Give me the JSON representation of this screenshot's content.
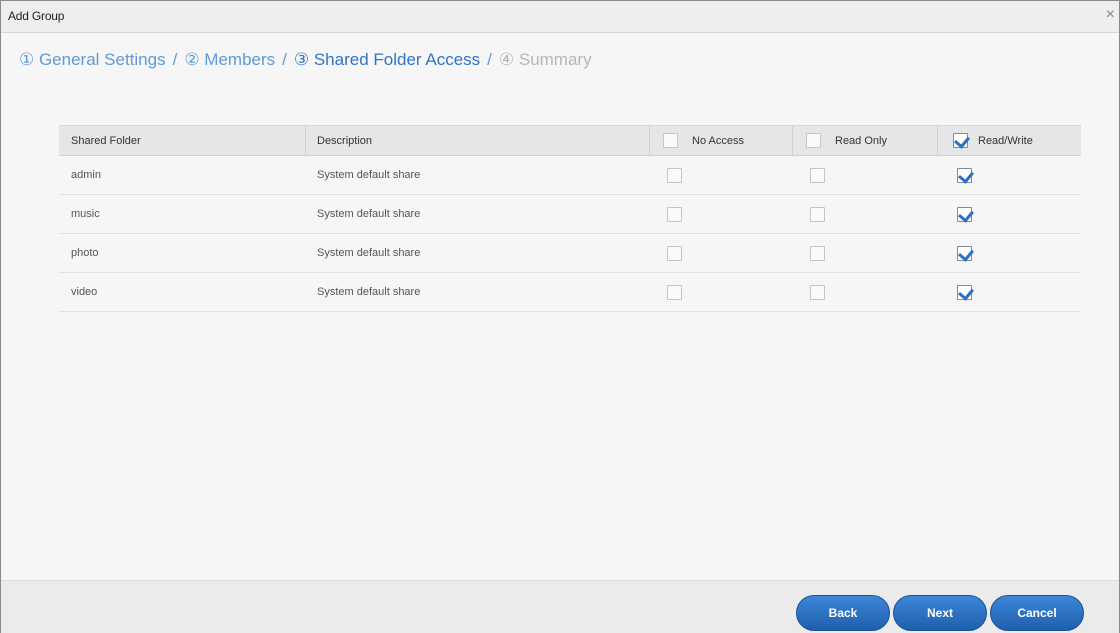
{
  "dialog": {
    "title": "Add Group",
    "close_glyph": "×"
  },
  "steps": [
    {
      "label": "① General Settings",
      "state": "done"
    },
    {
      "label": "② Members",
      "state": "done"
    },
    {
      "label": "③ Shared Folder Access",
      "state": "current"
    },
    {
      "label": "④ Summary",
      "state": "disabled"
    }
  ],
  "step_separator": "/",
  "table": {
    "headers": {
      "folder": "Shared Folder",
      "description": "Description",
      "no_access": "No Access",
      "read_only": "Read Only",
      "read_write": "Read/Write"
    },
    "header_checks": {
      "no_access": false,
      "read_only": false,
      "read_write": true
    },
    "rows": [
      {
        "folder": "admin",
        "description": "System default share",
        "no_access": false,
        "read_only": false,
        "read_write": true
      },
      {
        "folder": "music",
        "description": "System default share",
        "no_access": false,
        "read_only": false,
        "read_write": true
      },
      {
        "folder": "photo",
        "description": "System default share",
        "no_access": false,
        "read_only": false,
        "read_write": true
      },
      {
        "folder": "video",
        "description": "System default share",
        "no_access": false,
        "read_only": false,
        "read_write": true
      }
    ]
  },
  "buttons": {
    "back": "Back",
    "next": "Next",
    "cancel": "Cancel"
  },
  "colors": {
    "accent": "#2f74c4",
    "button": "#2a6fc0"
  }
}
